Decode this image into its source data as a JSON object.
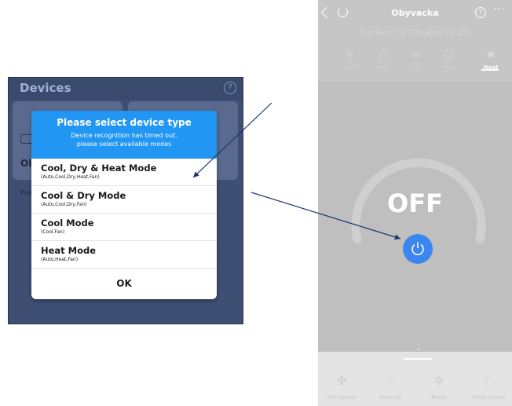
{
  "left_app": {
    "header_title": "Devices",
    "bg_card_text": "Oby",
    "bg_card_sub": "Pow",
    "dialog": {
      "title": "Please select device type",
      "subtitle_line1": "Device recognition has timed out.",
      "subtitle_line2": "please select available modes",
      "options": [
        {
          "name": "Cool, Dry & Heat Mode",
          "modes": "(Auto,Cool,Dry,Heat,Fan)"
        },
        {
          "name": "Cool & Dry Mode",
          "modes": "(Auto,Cool,Dry,Fan)"
        },
        {
          "name": "Cool Mode",
          "modes": "(Cool,Fan)"
        },
        {
          "name": "Heat Mode",
          "modes": "(Auto,Heat,Fan)"
        }
      ],
      "ok_label": "OK"
    }
  },
  "right_app": {
    "title": "Obyvacka",
    "temperature": "Outdoor:7.0℃/Indoor:23.0℃",
    "mode_tabs": [
      {
        "label": "Cool",
        "icon": "snowflake-icon",
        "active": false
      },
      {
        "label": "Dry",
        "icon": "droplet-icon",
        "active": false
      },
      {
        "label": "Fan",
        "icon": "fan-icon",
        "active": false
      },
      {
        "label": "Auto",
        "icon": "auto-icon",
        "active": false
      },
      {
        "label": "Heat",
        "icon": "sun-icon",
        "active": true
      }
    ],
    "status": "OFF",
    "features": [
      {
        "label": "Fan Speed",
        "icon": "fan-speed-icon"
      },
      {
        "label": "Favorite",
        "icon": "heart-icon"
      },
      {
        "label": "Boost",
        "icon": "boost-icon"
      },
      {
        "label": "Sleep Curve",
        "icon": "moon-icon"
      }
    ]
  },
  "colors": {
    "accent_blue": "#2196f3",
    "power_blue": "#3b86f0",
    "arrow_navy": "#1a3670"
  }
}
